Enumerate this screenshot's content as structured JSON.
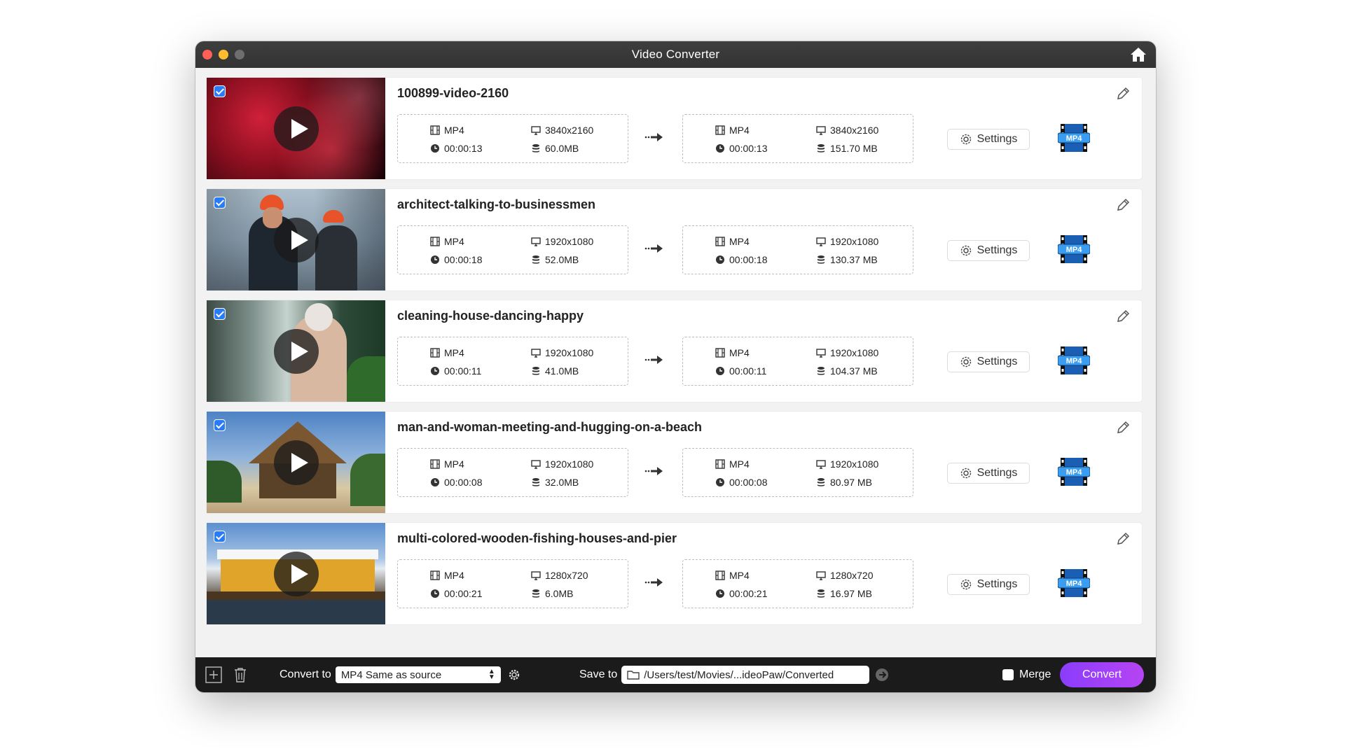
{
  "window": {
    "title": "Video Converter"
  },
  "colors": {
    "accent": "#2a7bf6",
    "convert_start": "#8a3dfb",
    "convert_end": "#b644f3",
    "titlebar": "#3a3a3a"
  },
  "icons": {
    "home": "home-icon",
    "edit": "pencil-icon",
    "format": "film-icon",
    "resolution": "monitor-icon",
    "duration": "clock-icon",
    "size": "database-icon",
    "arrow": "arrow-right-icon",
    "settings": "gear-icon"
  },
  "items": [
    {
      "name": "100899-video-2160",
      "source": {
        "format": "MP4",
        "resolution": "3840x2160",
        "duration": "00:00:13",
        "size": "60.0MB"
      },
      "output": {
        "format": "MP4",
        "resolution": "3840x2160",
        "duration": "00:00:13",
        "size": "151.70 MB"
      },
      "settings_label": "Settings",
      "badge": "MP4"
    },
    {
      "name": "architect-talking-to-businessmen",
      "source": {
        "format": "MP4",
        "resolution": "1920x1080",
        "duration": "00:00:18",
        "size": "52.0MB"
      },
      "output": {
        "format": "MP4",
        "resolution": "1920x1080",
        "duration": "00:00:18",
        "size": "130.37 MB"
      },
      "settings_label": "Settings",
      "badge": "MP4"
    },
    {
      "name": "cleaning-house-dancing-happy",
      "source": {
        "format": "MP4",
        "resolution": "1920x1080",
        "duration": "00:00:11",
        "size": "41.0MB"
      },
      "output": {
        "format": "MP4",
        "resolution": "1920x1080",
        "duration": "00:00:11",
        "size": "104.37 MB"
      },
      "settings_label": "Settings",
      "badge": "MP4"
    },
    {
      "name": "man-and-woman-meeting-and-hugging-on-a-beach",
      "source": {
        "format": "MP4",
        "resolution": "1920x1080",
        "duration": "00:00:08",
        "size": "32.0MB"
      },
      "output": {
        "format": "MP4",
        "resolution": "1920x1080",
        "duration": "00:00:08",
        "size": "80.97 MB"
      },
      "settings_label": "Settings",
      "badge": "MP4"
    },
    {
      "name": "multi-colored-wooden-fishing-houses-and-pier",
      "source": {
        "format": "MP4",
        "resolution": "1280x720",
        "duration": "00:00:21",
        "size": "6.0MB"
      },
      "output": {
        "format": "MP4",
        "resolution": "1280x720",
        "duration": "00:00:21",
        "size": "16.97 MB"
      },
      "settings_label": "Settings",
      "badge": "MP4"
    }
  ],
  "bottom": {
    "convert_to_label": "Convert to",
    "convert_to_value": "MP4 Same as source",
    "save_to_label": "Save to",
    "save_path": "/Users/test/Movies/...ideoPaw/Converted",
    "merge_label": "Merge",
    "convert_label": "Convert"
  }
}
